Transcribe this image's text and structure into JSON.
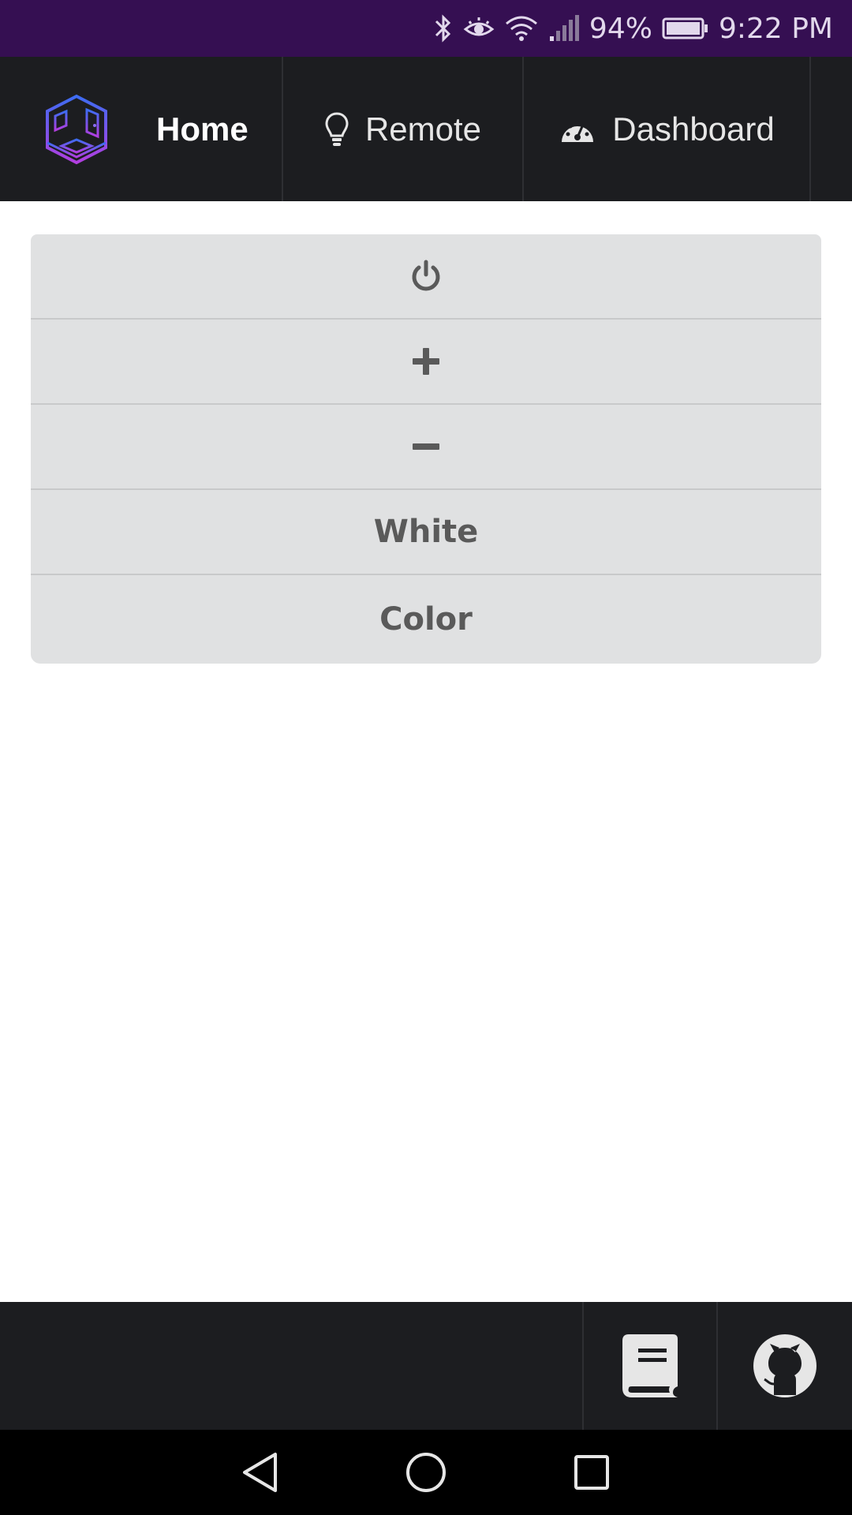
{
  "status_bar": {
    "battery": "94%",
    "time": "9:22 PM",
    "icons": [
      "bluetooth-icon",
      "eye-icon",
      "wifi-icon",
      "signal-icon",
      "battery-icon"
    ]
  },
  "nav": {
    "home_label": "Home",
    "remote_label": "Remote",
    "dashboard_label": "Dashboard",
    "icons": [
      "app-logo",
      "lightbulb-icon",
      "dashboard-gauge-icon"
    ]
  },
  "controls": {
    "buttons": [
      {
        "icon": "power-icon"
      },
      {
        "icon": "plus-icon"
      },
      {
        "icon": "minus-icon"
      },
      {
        "label": "White"
      },
      {
        "label": "Color"
      }
    ]
  },
  "footer": {
    "icons": [
      "book-icon",
      "github-icon"
    ]
  },
  "android_nav": {
    "icons": [
      "back-icon",
      "home-circle-icon",
      "recents-icon"
    ]
  },
  "colors": {
    "status_bar_bg": "#350f52",
    "nav_bg": "#1c1d20",
    "button_bg": "#e0e1e2",
    "button_text": "#5a5a5a",
    "logo_gradient_start": "#3d6cf2",
    "logo_gradient_end": "#b23ee0"
  }
}
